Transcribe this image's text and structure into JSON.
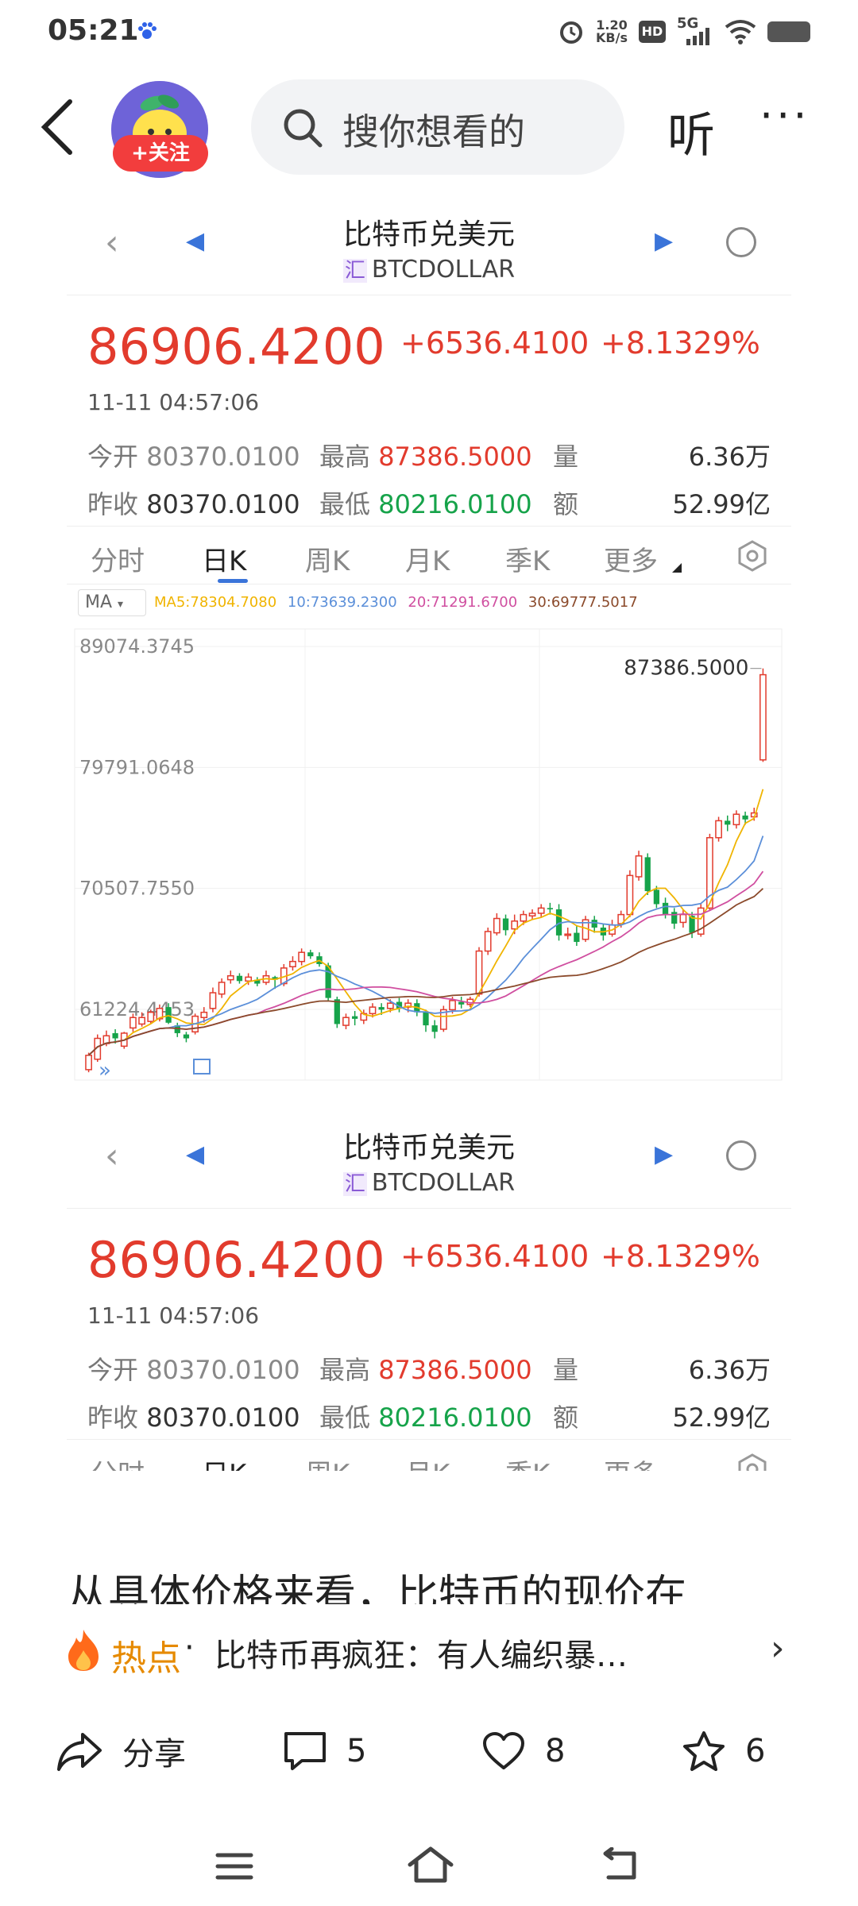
{
  "status_bar": {
    "time": "05:21",
    "net_speed_value": "1.20",
    "net_speed_unit": "KB/s",
    "hd": "HD",
    "network": "5G"
  },
  "topnav": {
    "follow_label": "+关注",
    "search_placeholder": "搜你想看的",
    "listen_label": "听",
    "more_label": "···"
  },
  "stock_card": {
    "title": "比特币兑美元",
    "market_tag": "汇",
    "symbol": "BTCDOLLAR",
    "price": "86906.4200",
    "change": "+6536.4100",
    "change_pct": "+8.1329%",
    "timestamp": "11-11 04:57:06",
    "quotes": {
      "open_label": "今开",
      "open_value": "80370.0100",
      "high_label": "最高",
      "high_value": "87386.5000",
      "volume_label": "量",
      "volume_value": "6.36万",
      "prev_close_label": "昨收",
      "prev_close_value": "80370.0100",
      "low_label": "最低",
      "low_value": "80216.0100",
      "amount_label": "额",
      "amount_value": "52.99亿"
    },
    "tabs": [
      "分时",
      "日K",
      "周K",
      "月K",
      "季K",
      "更多"
    ],
    "active_tab": "日K",
    "ma_select": "MA",
    "ma_values": {
      "ma5": "MA5:78304.7080",
      "ma10": "10:73639.2300",
      "ma20": "20:71291.6700",
      "ma30": "30:69777.5017"
    }
  },
  "chart_data": {
    "type": "candlestick",
    "ticks_y": [
      "89074.3745",
      "79791.0648",
      "70507.7550",
      "61224.4453"
    ],
    "max_label": "87386.5000",
    "colors": {
      "up": "#e23b2d",
      "down": "#16a34a",
      "ma5": "#f0b400",
      "ma10": "#5b8fd9",
      "ma20": "#d04fa0",
      "ma30": "#8b4a2b"
    },
    "candles": [
      [
        56600,
        57700,
        56400,
        57900
      ],
      [
        57400,
        59000,
        57200,
        59300
      ],
      [
        58600,
        59200,
        58400,
        59600
      ],
      [
        59400,
        59000,
        58600,
        59700
      ],
      [
        58400,
        59400,
        58200,
        59500
      ],
      [
        59800,
        60600,
        59500,
        60900
      ],
      [
        60100,
        60600,
        59900,
        61000
      ],
      [
        60300,
        61000,
        60100,
        61200
      ],
      [
        60500,
        61300,
        60300,
        61600
      ],
      [
        61400,
        60200,
        60100,
        61700
      ],
      [
        60000,
        59400,
        59100,
        60200
      ],
      [
        59300,
        59000,
        58700,
        59500
      ],
      [
        59500,
        60700,
        59300,
        60900
      ],
      [
        60600,
        61000,
        60200,
        61400
      ],
      [
        61300,
        62500,
        61000,
        62900
      ],
      [
        62400,
        63300,
        62100,
        63600
      ],
      [
        63500,
        63800,
        63200,
        64200
      ],
      [
        63800,
        63400,
        63200,
        64000
      ],
      [
        63400,
        63700,
        63100,
        64000
      ],
      [
        63500,
        63200,
        63000,
        63700
      ],
      [
        63300,
        63800,
        63100,
        64200
      ],
      [
        63700,
        63500,
        62800,
        63800
      ],
      [
        63200,
        64400,
        63000,
        64700
      ],
      [
        64500,
        64900,
        64200,
        65300
      ],
      [
        64900,
        65600,
        64600,
        65900
      ],
      [
        65600,
        65300,
        65100,
        65800
      ],
      [
        65300,
        64700,
        64500,
        65600
      ],
      [
        64600,
        62100,
        61900,
        64800
      ],
      [
        62000,
        60100,
        59800,
        62200
      ],
      [
        60000,
        60600,
        59700,
        60900
      ],
      [
        60700,
        60500,
        60000,
        61100
      ],
      [
        60400,
        60900,
        60100,
        61200
      ],
      [
        60900,
        61400,
        60600,
        61700
      ],
      [
        61400,
        61200,
        60800,
        61700
      ],
      [
        61300,
        61700,
        61000,
        62000
      ],
      [
        61800,
        61300,
        61000,
        62100
      ],
      [
        61400,
        61700,
        61000,
        62000
      ],
      [
        61700,
        61000,
        60700,
        62000
      ],
      [
        61000,
        60000,
        59500,
        61200
      ],
      [
        60000,
        59500,
        59000,
        60400
      ],
      [
        59700,
        61200,
        59500,
        61500
      ],
      [
        61200,
        61900,
        60900,
        62200
      ],
      [
        61800,
        61600,
        61300,
        62200
      ],
      [
        61600,
        62000,
        61400,
        62200
      ],
      [
        62400,
        65700,
        62200,
        66000
      ],
      [
        65700,
        67200,
        65400,
        67500
      ],
      [
        67100,
        68200,
        66900,
        68600
      ],
      [
        68200,
        67300,
        66900,
        68500
      ],
      [
        67400,
        68000,
        67000,
        68500
      ],
      [
        68000,
        68500,
        67700,
        68800
      ],
      [
        68400,
        68600,
        68100,
        68900
      ],
      [
        68600,
        69000,
        68300,
        69300
      ],
      [
        69000,
        68900,
        68500,
        69400
      ],
      [
        68900,
        66900,
        66500,
        69300
      ],
      [
        66900,
        67000,
        66600,
        67500
      ],
      [
        67100,
        66400,
        66100,
        67600
      ],
      [
        66600,
        68100,
        66400,
        68400
      ],
      [
        68100,
        67500,
        67100,
        68400
      ],
      [
        67500,
        66900,
        66500,
        67800
      ],
      [
        67000,
        67700,
        66800,
        68100
      ],
      [
        67800,
        68500,
        67500,
        68800
      ],
      [
        68500,
        71500,
        68300,
        71900
      ],
      [
        71400,
        73000,
        71100,
        73400
      ],
      [
        72900,
        70300,
        70000,
        73200
      ],
      [
        70400,
        69300,
        69000,
        70700
      ],
      [
        69400,
        68500,
        68200,
        69800
      ],
      [
        68700,
        67800,
        67400,
        69000
      ],
      [
        67900,
        68500,
        67500,
        68900
      ],
      [
        68400,
        67100,
        66700,
        68700
      ],
      [
        67000,
        69000,
        66800,
        69300
      ],
      [
        69000,
        74400,
        68800,
        74700
      ],
      [
        74400,
        75700,
        74100,
        76000
      ],
      [
        75700,
        75400,
        74900,
        76100
      ],
      [
        75400,
        76200,
        75100,
        76500
      ],
      [
        76100,
        75800,
        75400,
        76400
      ],
      [
        76000,
        76300,
        75700,
        76700
      ],
      [
        80370,
        86906,
        80216,
        87386
      ]
    ]
  },
  "article": {
    "first_line": "从具体价格来看，比特币的现价在",
    "hot_label": "热点",
    "hot_dot": "·",
    "hot_title": "比特币再疯狂：有人编织暴…"
  },
  "actions": {
    "share_label": "分享",
    "comments_count": "5",
    "likes_count": "8",
    "favorites_count": "6"
  }
}
